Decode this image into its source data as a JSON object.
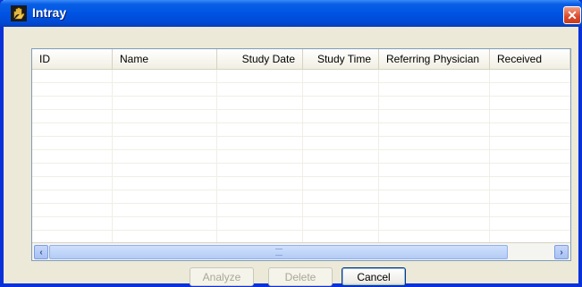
{
  "window": {
    "title": "Intray",
    "title_icon": "hand-icon",
    "close_icon": "close-icon"
  },
  "listview": {
    "columns": [
      {
        "label": "ID",
        "align": "left"
      },
      {
        "label": "Name",
        "align": "left"
      },
      {
        "label": "Study Date",
        "align": "right"
      },
      {
        "label": "Study Time",
        "align": "right"
      },
      {
        "label": "Referring Physician",
        "align": "left"
      },
      {
        "label": "Received",
        "align": "left"
      }
    ],
    "rows": []
  },
  "scrollbar": {
    "left_arrow": "‹",
    "right_arrow": "›"
  },
  "buttons": {
    "analyze": {
      "label": "Analyze",
      "enabled": false
    },
    "delete": {
      "label": "Delete",
      "enabled": false
    },
    "cancel": {
      "label": "Cancel",
      "enabled": true
    }
  },
  "colors": {
    "titlebar": "#0054e3",
    "close": "#d94a2a"
  }
}
